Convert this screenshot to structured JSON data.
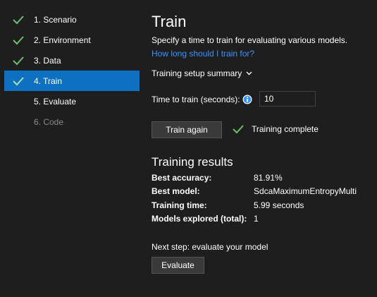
{
  "sidebar": {
    "steps": [
      {
        "label": "1. Scenario",
        "state": "done"
      },
      {
        "label": "2. Environment",
        "state": "done"
      },
      {
        "label": "3. Data",
        "state": "done"
      },
      {
        "label": "4. Train",
        "state": "active"
      },
      {
        "label": "5. Evaluate",
        "state": "pending"
      },
      {
        "label": "6. Code",
        "state": "disabled"
      }
    ]
  },
  "main": {
    "title": "Train",
    "subtitle": "Specify a time to train for evaluating various models.",
    "help_link": "How long should I train for?",
    "summary_toggle": "Training setup summary",
    "time_label": "Time to train (seconds):",
    "time_value": "10",
    "train_button": "Train again",
    "status_text": "Training complete",
    "results_title": "Training results",
    "results": [
      {
        "key": "Best accuracy:",
        "value": "81.91%"
      },
      {
        "key": "Best model:",
        "value": "SdcaMaximumEntropyMulti"
      },
      {
        "key": "Training time:",
        "value": "5.99 seconds"
      },
      {
        "key": "Models explored (total):",
        "value": "1"
      }
    ],
    "next_step": "Next step: evaluate your model",
    "evaluate_button": "Evaluate"
  },
  "colors": {
    "background": "#1e1e1e",
    "active_step": "#0e70c0",
    "link": "#3794ff",
    "check": "#6cbf6c",
    "info": "#3794ff"
  },
  "icons": {
    "check": "check-icon",
    "info": "info-icon",
    "chevron": "chevron-down-icon"
  }
}
